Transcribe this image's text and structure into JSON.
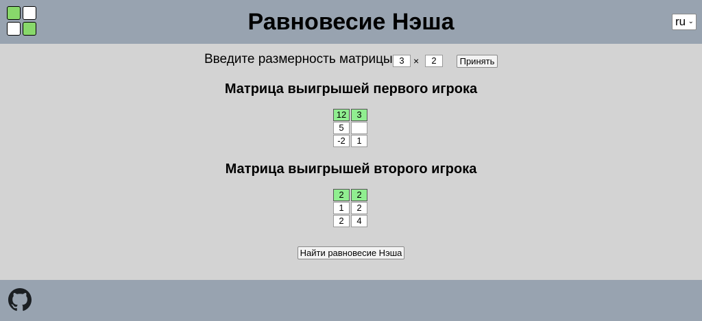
{
  "header": {
    "title": "Равновесие Нэша",
    "language": "ru"
  },
  "dimensions": {
    "label": "Введите размерность матрицы:",
    "rows": "3",
    "times": "×",
    "cols": "2",
    "accept_label": "Принять"
  },
  "matrix1": {
    "title": "Матрица выигрышей первого игрока",
    "rows": [
      [
        {
          "value": "12",
          "highlight": true
        },
        {
          "value": "3",
          "highlight": true
        }
      ],
      [
        {
          "value": "5",
          "highlight": false
        },
        {
          "value": "",
          "highlight": false
        }
      ],
      [
        {
          "value": "-2",
          "highlight": false
        },
        {
          "value": "1",
          "highlight": false
        }
      ]
    ]
  },
  "matrix2": {
    "title": "Матрица выигрышей второго игрока",
    "rows": [
      [
        {
          "value": "2",
          "highlight": true
        },
        {
          "value": "2",
          "highlight": true
        }
      ],
      [
        {
          "value": "1",
          "highlight": false
        },
        {
          "value": "2",
          "highlight": false
        }
      ],
      [
        {
          "value": "2",
          "highlight": false
        },
        {
          "value": "4",
          "highlight": false
        }
      ]
    ]
  },
  "actions": {
    "find_label": "Найти равновесие Нэша"
  },
  "footer": {
    "icon": "github-icon"
  },
  "colors": {
    "bar": "#98a3b0",
    "background": "#d3d3d3",
    "highlight": "#90ee90",
    "logo_green": "#88d86b"
  }
}
